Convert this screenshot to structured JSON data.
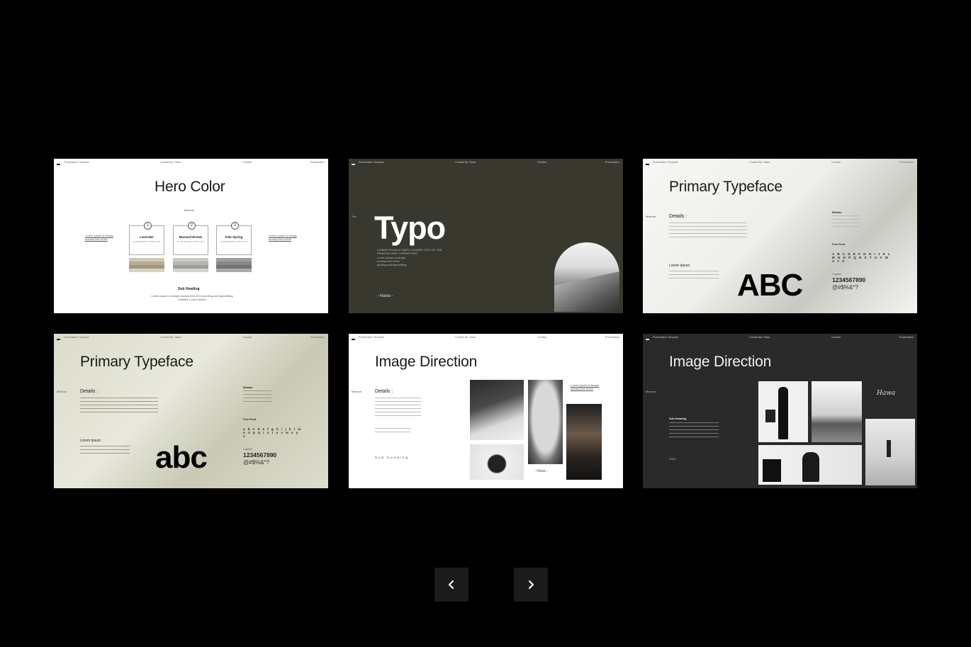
{
  "header": {
    "left": "Presentation Template",
    "center": "Created By: Hawa",
    "mid": "Creative",
    "right": "Presentation"
  },
  "slide1": {
    "title": "Hero Color",
    "subtitle": "Minimal",
    "left_note": "Lorem Ipsum is simply dummy text of the",
    "right_note": "Lorem Ipsum is simply dummy text of the",
    "swatches": [
      {
        "num": "1",
        "name": "Lavender",
        "code": "C:??% M:??% Y:??% K:??%",
        "colors": [
          "#cfc8b4",
          "#b8ae95",
          "#a09679",
          "#d7d1c0"
        ]
      },
      {
        "num": "2",
        "name": "Mustard Brown",
        "code": "C:??% M:??% Y:??% K:??%",
        "colors": [
          "#c9c9c5",
          "#b5b5b1",
          "#9c9c98",
          "#d3d3cf"
        ]
      },
      {
        "num": "3",
        "name": "Pale Spring",
        "code": "C:??% M:??% Y:??% K:??%",
        "colors": [
          "#9e9e9e",
          "#888",
          "#737373",
          "#aaa"
        ]
      }
    ],
    "sub_heading": "Sub Heading",
    "sub_text": "Lorem ipsum is simply dummy text of the printing and typesetting industry. Lorem Ipsum"
  },
  "slide2": {
    "side_label": "The",
    "title": "Typo",
    "caption": "LOREM IPSUM IS SIMPLY DUMMY TEXT OF THE PRINTING AND TYPESETTING",
    "bullets": [
      "Lorem Ipsum is simply",
      "dummy text of the",
      "printing and typesetting"
    ],
    "author": "- Hawa -"
  },
  "slide3": {
    "title": "Primary Typeface",
    "side": "Minimal",
    "details": "Details :",
    "lorem": "Lorem Ipsum",
    "font_name": "Bebato",
    "free_font": "Free Font",
    "alphabet": "A B C D E F G H I J K L M N O P Q R S T U V W X Y Z",
    "capital": "Capital",
    "numbers": "1234567890",
    "symbols": "@#$%&*?",
    "sample": "ABC"
  },
  "slide4": {
    "title": "Primary Typeface",
    "side": "Minimal",
    "details": "Details :",
    "lorem": "Lorem Ipsum",
    "font_name": "Bebato",
    "free_font": "Free Font",
    "alphabet": "a b c d e f g h i j k l m n o p q r s t u v w x y z",
    "capital": "Capital",
    "numbers": "1234567890",
    "symbols": "@#$%&*?",
    "sample": "abc"
  },
  "slide5": {
    "title": "Image Direction",
    "side": "Minimal",
    "details": "Details :",
    "sub_heading": "Sub Heading",
    "note": "Lorem Ipsum is simply dummy text of the",
    "signature": "- Hawa -"
  },
  "slide6": {
    "title": "Image Direction",
    "side": "Minimal",
    "sub_heading": "Sub Heading",
    "year": "2020",
    "signature": "Hawa"
  },
  "nav": {
    "prev_icon": "chevron-left-icon",
    "next_icon": "chevron-right-icon"
  }
}
